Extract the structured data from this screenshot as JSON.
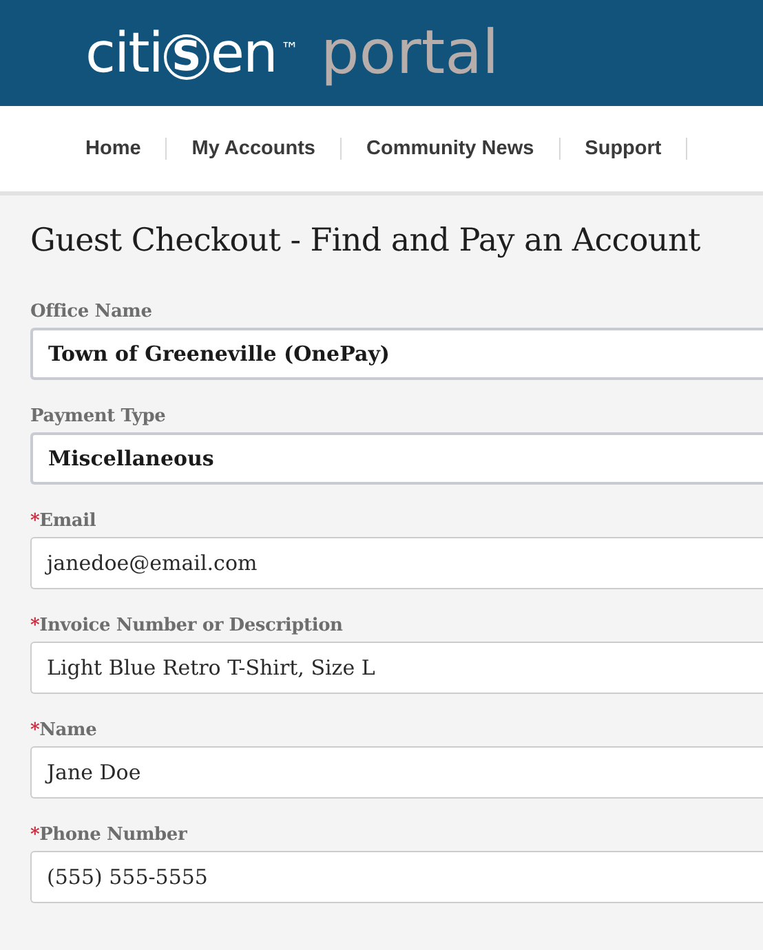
{
  "header": {
    "logo_parts": [
      "citi",
      "S",
      "en"
    ],
    "trademark": "™",
    "suffix": "portal"
  },
  "nav": {
    "items": [
      {
        "label": "Home"
      },
      {
        "label": "My Accounts"
      },
      {
        "label": "Community News"
      },
      {
        "label": "Support"
      }
    ]
  },
  "page_title": "Guest Checkout - Find and Pay an Account",
  "fields": [
    {
      "kind": "select",
      "label": "Office Name",
      "value": "Town of Greeneville (OnePay)"
    },
    {
      "kind": "select",
      "label": "Payment Type",
      "value": "Miscellaneous"
    },
    {
      "kind": "input",
      "label": "Email",
      "required_mark": "*",
      "value": "janedoe@email.com"
    },
    {
      "kind": "input",
      "label": "Invoice Number or Description",
      "required_mark": "*",
      "value": "Light Blue Retro T-Shirt, Size L"
    },
    {
      "kind": "input",
      "label": "Name",
      "required_mark": "*",
      "value": "Jane Doe"
    },
    {
      "kind": "input",
      "label": "Phone Number",
      "required_mark": "*",
      "value": "(555) 555-5555"
    }
  ]
}
